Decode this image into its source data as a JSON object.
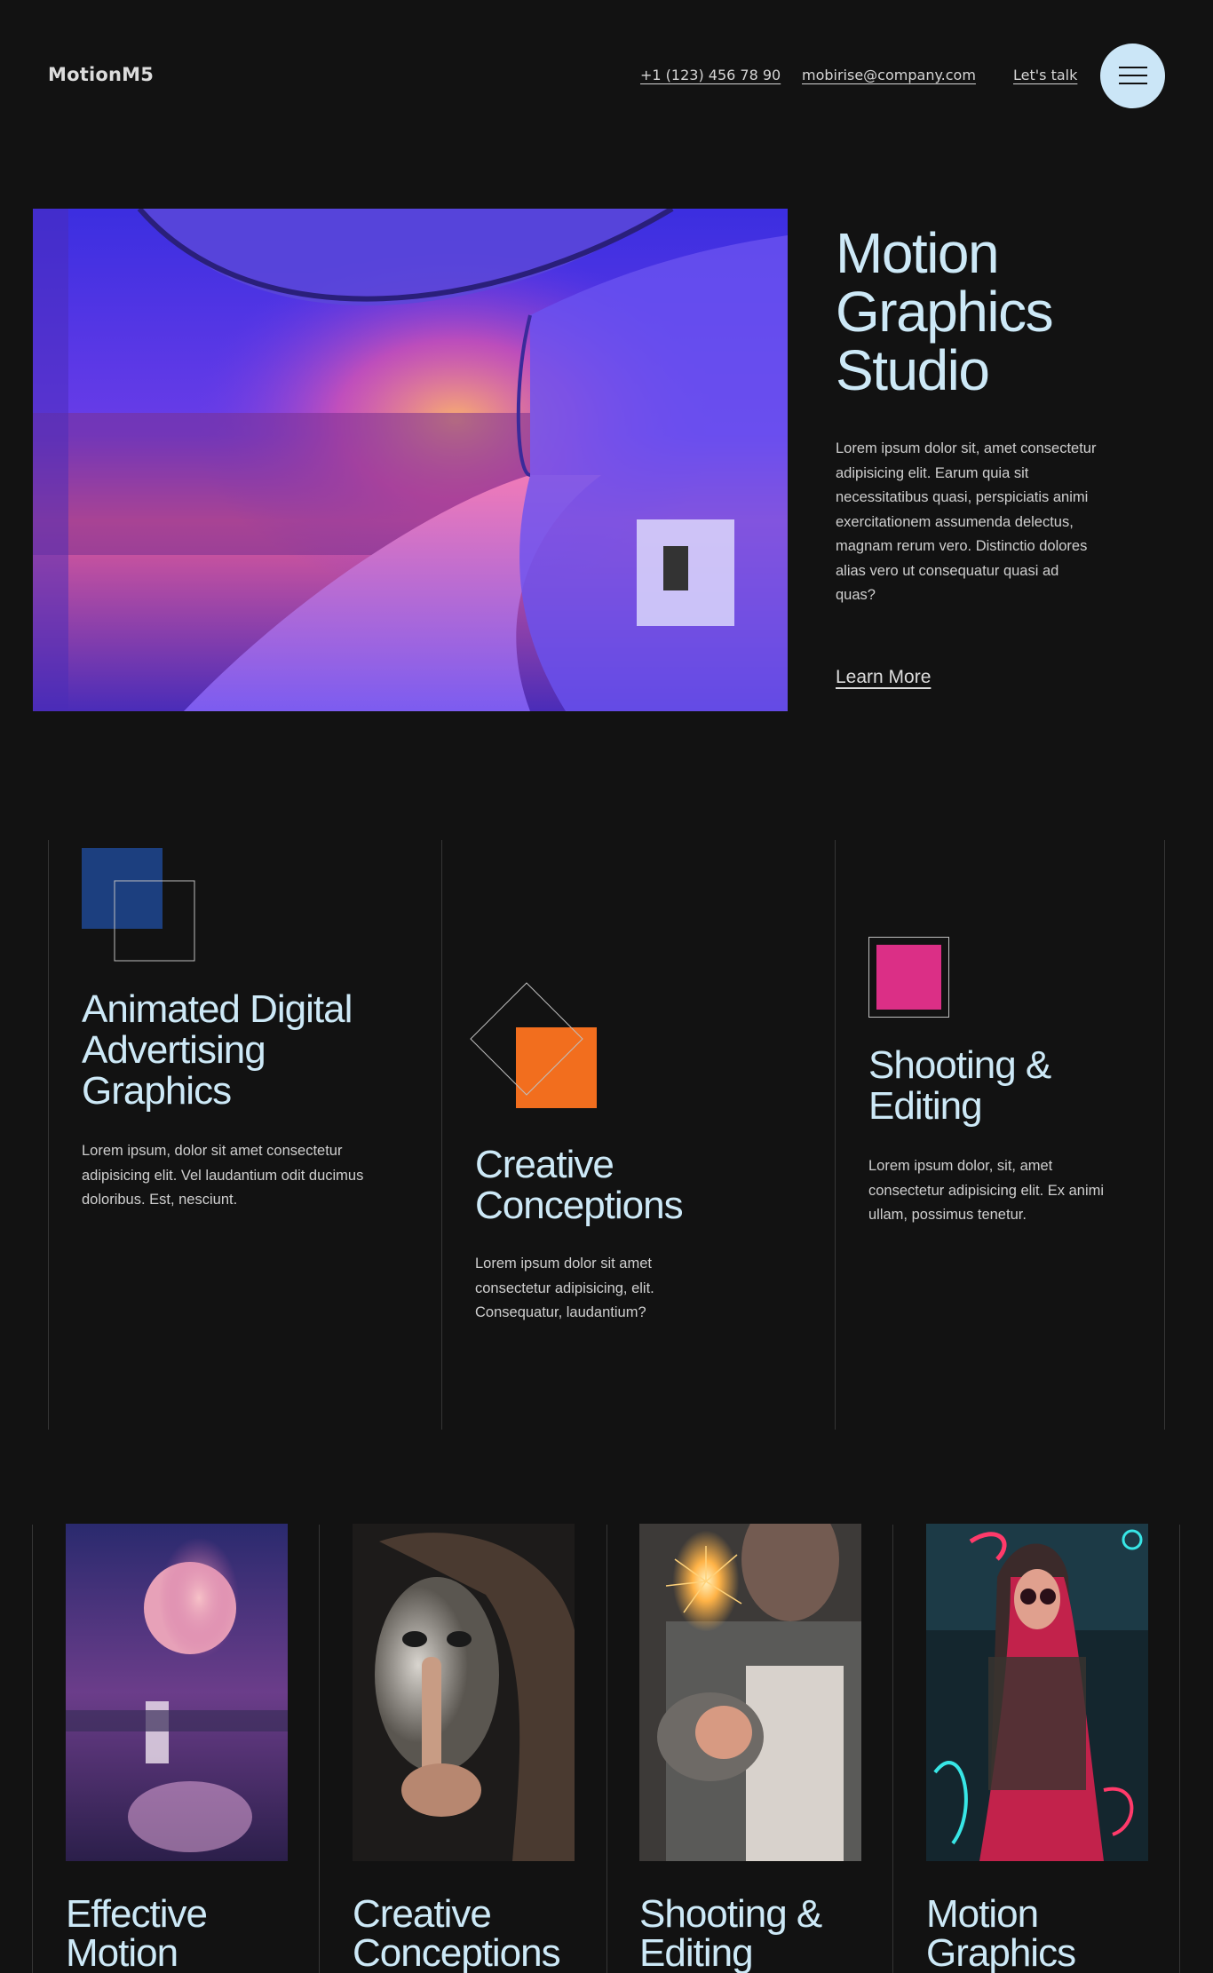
{
  "header": {
    "brand": "MotionM5",
    "phone": "+1 (123) 456 78 90",
    "email": "mobirise@company.com",
    "cta": "Let's talk",
    "menu_icon": "hamburger-icon"
  },
  "hero": {
    "title": "Motion Graphics Studio",
    "text": "Lorem ipsum dolor sit, amet consectetur adipisicing elit. Earum quia sit necessitatibus quasi, perspiciatis animi exercitationem assumenda delectus, magnam rerum vero. Distinctio dolores alias vero ut consequatur quasi ad quas?",
    "link": "Learn More"
  },
  "features": [
    {
      "title": "Animated Digital Advertising Graphics",
      "text": "Lorem ipsum, dolor sit amet consectetur adipisicing elit. Vel laudantium odit ducimus doloribus. Est, nesciunt.",
      "icon_color": "#1c3f7f"
    },
    {
      "title": "Creative Conceptions",
      "text": "Lorem ipsum dolor sit amet consectetur adipisicing, elit. Consequatur, laudantium?",
      "icon_color": "#f26e1e"
    },
    {
      "title": "Shooting & Editing",
      "text": "Lorem ipsum dolor, sit, amet consectetur adipisicing elit. Ex animi ullam, possimus tenetur.",
      "icon_color": "#db2f86"
    }
  ],
  "cards": [
    {
      "title": "Effective Motion"
    },
    {
      "title": "Creative Conceptions"
    },
    {
      "title": "Shooting & Editing"
    },
    {
      "title": "Motion Graphics"
    }
  ],
  "colors": {
    "background": "#121212",
    "heading": "#cde9f7",
    "menu_button": "#cbe6f7"
  }
}
